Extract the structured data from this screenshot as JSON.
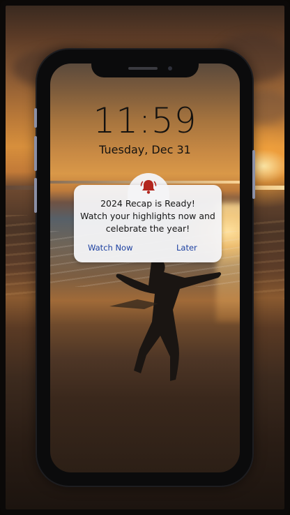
{
  "lock_screen": {
    "time": "11:59",
    "date": "Tuesday, Dec 31"
  },
  "notification": {
    "icon": "bell-icon",
    "icon_color": "#b3261e",
    "lines": [
      "2024 Recap is Ready!",
      "Watch your highlights now and",
      "celebrate the year!"
    ],
    "primary_action": "Watch Now",
    "secondary_action": "Later",
    "action_color": "#1b3fa0"
  }
}
